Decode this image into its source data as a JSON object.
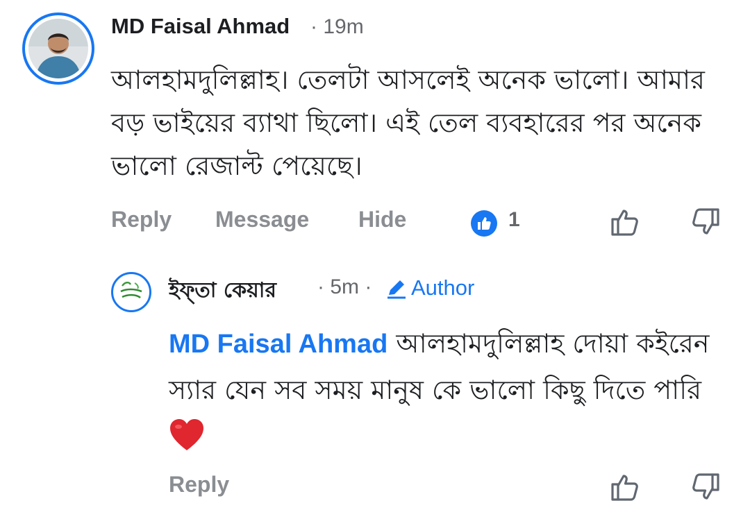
{
  "comment": {
    "author": "MD Faisal Ahmad",
    "time": "· 19m",
    "text": "আলহামদুলিল্লাহ। তেলটা আসলেই অনেক ভালো। আমার বড় ভাইয়ের ব্যাথা ছিলো। এই তেল ব্যবহারের পর অনেক ভালো রেজাল্ট পেয়েছে।",
    "actions": {
      "reply": "Reply",
      "message": "Message",
      "hide": "Hide"
    },
    "reaction_count": "1"
  },
  "reply": {
    "author": "ইফ্তা কেয়ার",
    "time": "· 5m ·",
    "badge": "Author",
    "mention": "MD Faisal Ahmad",
    "text": "আলহামদুলিল্লাহ দোয়া কইরেন স্যার যেন সব সময় মানুষ কে ভালো কিছু দিতে পারি",
    "emoji": "❤️",
    "actions": {
      "reply": "Reply"
    }
  },
  "colors": {
    "accent": "#1877f2",
    "muted": "#8a8d91",
    "text": "#1c1e21"
  }
}
